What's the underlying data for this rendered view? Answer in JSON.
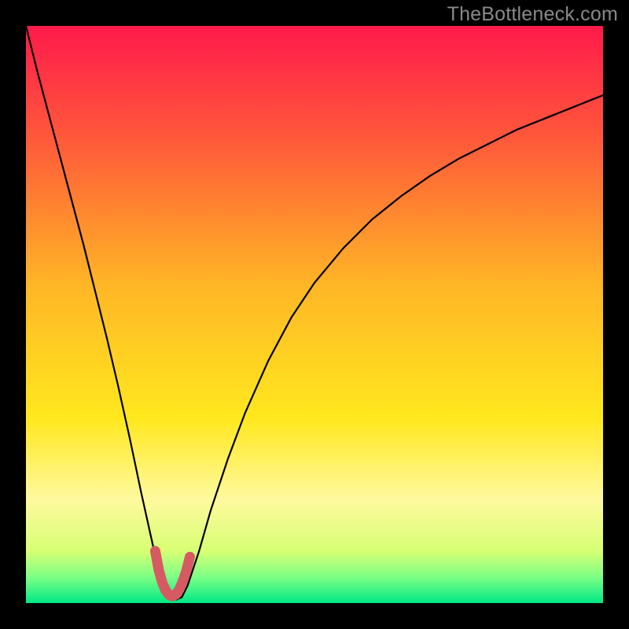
{
  "watermark": "TheBottleneck.com",
  "chart_data": {
    "type": "line",
    "title": "",
    "xlabel": "",
    "ylabel": "",
    "xrange": [
      0,
      100
    ],
    "yrange": [
      0,
      100
    ],
    "background_gradient": {
      "stops": [
        {
          "pos": 0.0,
          "color": "#ff1a4b"
        },
        {
          "pos": 0.2,
          "color": "#ff5a3a"
        },
        {
          "pos": 0.45,
          "color": "#ffb626"
        },
        {
          "pos": 0.68,
          "color": "#ffe81e"
        },
        {
          "pos": 0.82,
          "color": "#fff99e"
        },
        {
          "pos": 0.91,
          "color": "#d7ff74"
        },
        {
          "pos": 0.955,
          "color": "#7cff85"
        },
        {
          "pos": 1.0,
          "color": "#00e886"
        }
      ]
    },
    "series": [
      {
        "name": "bottleneck-curve",
        "color": "#000000",
        "width": 2.2,
        "x": [
          0.0,
          2,
          4,
          6,
          8,
          10,
          12,
          14,
          16,
          18,
          20,
          22,
          23,
          24,
          25,
          26,
          27,
          28,
          30,
          32,
          35,
          38,
          42,
          46,
          50,
          55,
          60,
          65,
          70,
          75,
          80,
          85,
          90,
          95,
          100
        ],
        "y": [
          100,
          92,
          84.5,
          77,
          69.5,
          62,
          54,
          46,
          37.5,
          28.5,
          19,
          10,
          6,
          3,
          1.2,
          0.6,
          1,
          3,
          9,
          16,
          25,
          33,
          42,
          49.5,
          55.5,
          61.5,
          66.5,
          70.5,
          74,
          77,
          79.5,
          82,
          84,
          86,
          88
        ]
      },
      {
        "name": "sweet-spot-marker",
        "color": "#d65a62",
        "width": 13,
        "linecap": "round",
        "x": [
          22.4,
          23.0,
          23.6,
          24.2,
          24.8,
          25.4,
          26.0,
          26.6,
          27.2,
          27.8,
          28.4
        ],
        "y": [
          9.0,
          5.8,
          3.6,
          2.2,
          1.4,
          1.2,
          1.5,
          2.4,
          3.8,
          5.6,
          8.0
        ]
      }
    ]
  }
}
